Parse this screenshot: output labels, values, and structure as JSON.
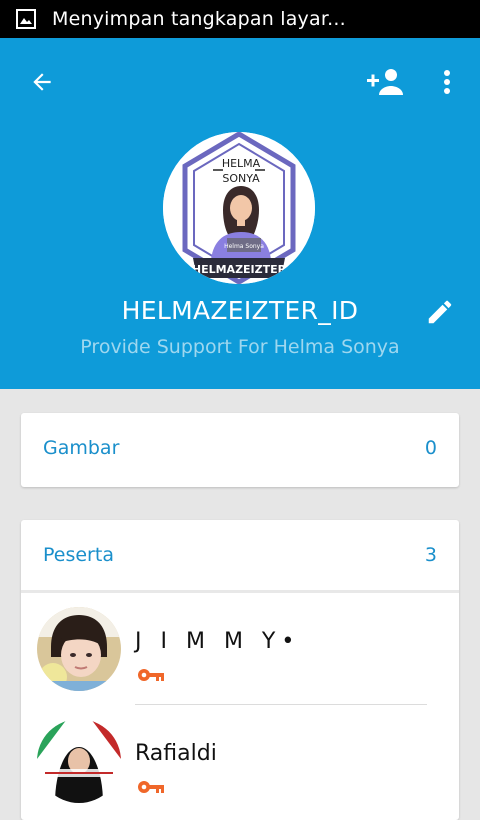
{
  "status_bar": {
    "notification_text": "Menyimpan tangkapan layar...",
    "icon": "image-icon"
  },
  "header": {
    "background_color": "#0e9bd9",
    "back_icon": "arrow-back-icon",
    "add_member_icon": "person-add-icon",
    "more_icon": "more-vertical-icon",
    "edit_icon": "pencil-icon",
    "group_name": "HELMAZEIZTER_ID",
    "group_description": "Provide Support For Helma Sonya",
    "avatar": {
      "top_text_line1": "HELMA",
      "top_text_line2": "SONYA",
      "shirt_text": "Helma Sonya",
      "banner_text": "HELMAZEIZTER"
    }
  },
  "images_section": {
    "label": "Gambar",
    "count": "0"
  },
  "members_section": {
    "label": "Peserta",
    "count": "3",
    "members": [
      {
        "name": "J I M M Y•",
        "role_icon": "key-icon"
      },
      {
        "name": "Rafialdi",
        "role_icon": "key-icon"
      }
    ]
  },
  "colors": {
    "accent": "#1a8fcb",
    "key": "#f0672a"
  }
}
